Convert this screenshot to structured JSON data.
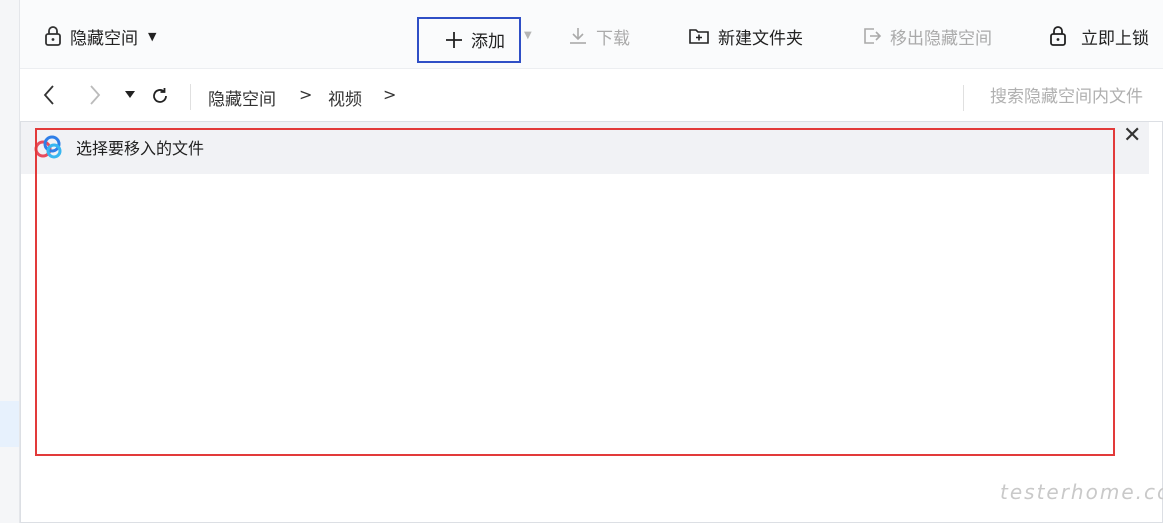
{
  "toolbar": {
    "space_label": "隐藏空间",
    "add_label": "添加",
    "download_label": "下载",
    "new_folder_label": "新建文件夹",
    "move_out_label": "移出隐藏空间",
    "lock_label": "立即上锁"
  },
  "nav": {
    "breadcrumb": [
      "隐藏空间",
      "视频"
    ],
    "search_placeholder": "搜索隐藏空间内文件"
  },
  "dialog": {
    "title": "选择要移入的文件",
    "close_glyph": "✕"
  },
  "watermark": "testerhome.com",
  "colors": {
    "highlight_blue": "#2f4fc6",
    "highlight_red": "#e23a3a"
  }
}
